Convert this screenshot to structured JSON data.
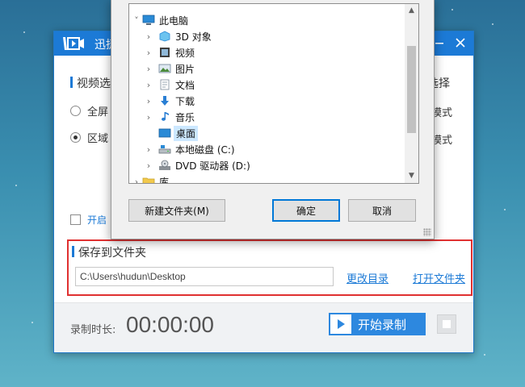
{
  "app": {
    "title": "迅捷",
    "sections": {
      "video_source": "视频选",
      "right_header": "选择",
      "save_folder": "保存到文件夹"
    },
    "radios": [
      {
        "label": "全屏",
        "checked": false
      },
      {
        "label": "区域",
        "checked": true
      }
    ],
    "modes": [
      "模式",
      "模式"
    ],
    "checkbox_label": "开启",
    "save_path": "C:\\Users\\hudun\\Desktop",
    "links": {
      "change_dir": "更改目录",
      "open_folder": "打开文件夹"
    },
    "footer": {
      "duration_label": "录制时长:",
      "duration_value": "00:00:00",
      "start_label": "开始录制"
    },
    "colors": {
      "brand": "#1c7ad6",
      "highlight": "#e03131"
    }
  },
  "dialog": {
    "tree": [
      {
        "label": "此电脑",
        "icon": "computer-icon",
        "expanded": true,
        "selected": false
      },
      {
        "label": "3D 对象",
        "icon": "3d-objects-icon",
        "expanded": false,
        "selected": false
      },
      {
        "label": "视频",
        "icon": "video-folder-icon",
        "expanded": false,
        "selected": false
      },
      {
        "label": "图片",
        "icon": "pictures-folder-icon",
        "expanded": false,
        "selected": false
      },
      {
        "label": "文档",
        "icon": "documents-folder-icon",
        "expanded": false,
        "selected": false
      },
      {
        "label": "下载",
        "icon": "downloads-folder-icon",
        "expanded": false,
        "selected": false
      },
      {
        "label": "音乐",
        "icon": "music-folder-icon",
        "expanded": false,
        "selected": false
      },
      {
        "label": "桌面",
        "icon": "desktop-folder-icon",
        "expanded": false,
        "selected": true
      },
      {
        "label": "本地磁盘 (C:)",
        "icon": "local-disk-icon",
        "expanded": false,
        "selected": false
      },
      {
        "label": "DVD 驱动器 (D:)",
        "icon": "dvd-drive-icon",
        "expanded": false,
        "selected": false
      },
      {
        "label": "库",
        "icon": "library-folder-icon",
        "expanded": false,
        "selected": false
      }
    ],
    "buttons": {
      "new_folder": "新建文件夹(M)",
      "ok": "确定",
      "cancel": "取消"
    }
  }
}
